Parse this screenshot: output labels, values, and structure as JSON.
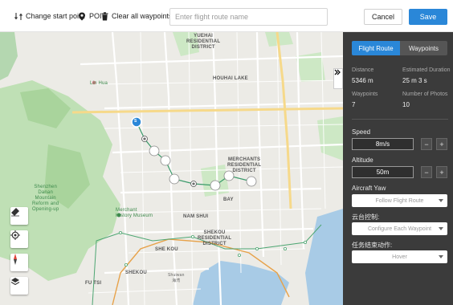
{
  "toolbar": {
    "change_start_point": "Change start point",
    "poi": "POI",
    "clear_waypoints": "Clear all waypoints",
    "route_name_placeholder": "Enter flight route name",
    "cancel": "Cancel",
    "save": "Save"
  },
  "map": {
    "start_marker": "S",
    "labels": {
      "yuehai": "YUEHAI\nRESIDENTIAL\nDISTRICT",
      "houhai_lake": "HOUHAI LAKE",
      "merchants": "MERCHANTS\nRESIDENTIAL\nDISTRICT",
      "bay": "BAY",
      "nam_shui": "NAM SHUI",
      "shekou_res": "SHEKOU\nRESIDENTIAL\nDISTRICT",
      "she_kou": "SHE KOU",
      "fu_tsi": "FU TSI",
      "shekou": "SHEKOU",
      "museum": "Merchant\nHistory Museum",
      "shenzhen_park": "Shenzhen\nDanan\nMountain\nReform and\nOpening-up",
      "lin_hua": "Lin Hua",
      "shuiwan": "Shuiwan\n海湾"
    }
  },
  "panel": {
    "tab_flight_route": "Flight Route",
    "tab_waypoints": "Waypoints",
    "distance_label": "Distance",
    "distance_value": "5346 m",
    "duration_label": "Estimated Duration",
    "duration_value": "25 m 3 s",
    "waypoints_label": "Waypoints",
    "waypoints_value": "7",
    "photos_label": "Number of Photos",
    "photos_value": "10",
    "speed_label": "Speed",
    "speed_value": "8m/s",
    "altitude_label": "Altitude",
    "altitude_value": "50m",
    "yaw_label": "Aircraft Yaw",
    "yaw_value": "Follow Flight Route",
    "gimbal_label": "云台控制:",
    "gimbal_value": "Configure Each Waypoint",
    "finish_label": "任务结束动作:",
    "finish_value": "Hover",
    "minus": "−",
    "plus": "+"
  },
  "colors": {
    "accent": "#2a87d8",
    "panel_bg": "#3b3b3b",
    "route_line": "#3a9a6a"
  }
}
